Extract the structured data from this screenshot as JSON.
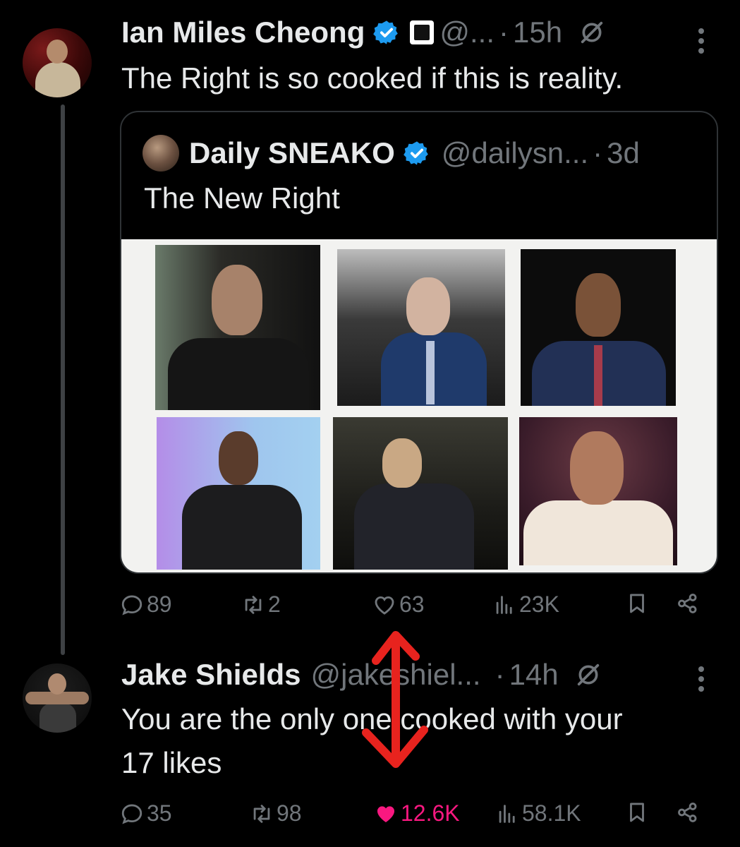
{
  "tweet": {
    "author_name": "Ian Miles Cheong",
    "author_handle": "@...",
    "dot": "·",
    "time": "15h",
    "text": "The Right is so cooked if this is reality.",
    "quote": {
      "author_name": "Daily SNEAKO",
      "author_handle": "@dailysn...",
      "dot": "·",
      "time": "3d",
      "text": "The New Right"
    },
    "actions": {
      "replies": "89",
      "reposts": "2",
      "likes": "63",
      "views": "23K"
    }
  },
  "reply": {
    "author_name": "Jake Shields",
    "author_handle": "@jakeshiel...",
    "dot": "·",
    "time": "14h",
    "text_line1": "You are the only one cooked with your",
    "text_line2": "17 likes",
    "actions": {
      "replies": "35",
      "reposts": "98",
      "likes": "12.6K",
      "views": "58.1K"
    }
  },
  "colors": {
    "background": "#000000",
    "text": "#e7e9ea",
    "muted": "#71767b",
    "verified": "#1d9bf0",
    "like": "#f91880",
    "annotation": "#e8231e"
  },
  "icons": [
    "verified-badge-icon",
    "affiliate-badge-icon",
    "grok-icon",
    "more-icon",
    "reply-icon",
    "repost-icon",
    "like-icon",
    "views-icon",
    "bookmark-icon",
    "share-icon"
  ]
}
